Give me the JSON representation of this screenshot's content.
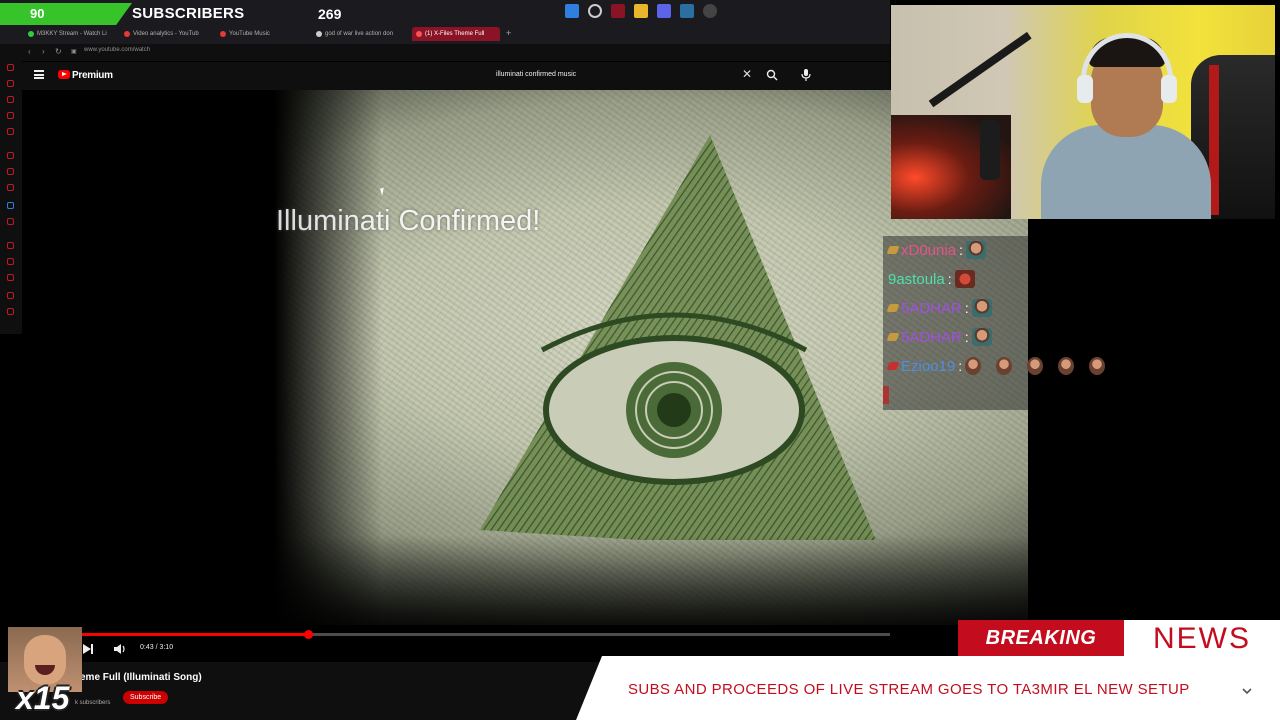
{
  "browser": {
    "tabs": [
      {
        "label": "M3KKY Stream - Watch Li",
        "color": "#2ecc40",
        "active": false
      },
      {
        "label": "Video analytics - YouTub",
        "color": "#e53935",
        "active": false
      },
      {
        "label": "YouTube Music",
        "color": "#e53935",
        "active": false
      },
      {
        "label": "god of war live action don",
        "color": "#cccccc",
        "active": false
      },
      {
        "label": "(1) X-Files Theme Full",
        "color": "#e53935",
        "active": true
      }
    ],
    "url": "www.youtube.com/watch"
  },
  "youtube": {
    "logo_label": "Premium",
    "search_query": "illuminati confirmed music",
    "video_caption": "Illuminati Confirmed!",
    "time_display": "0:43 / 3:10",
    "progress_fraction": 0.33,
    "video_title": "eme Full (Illuminati Song)",
    "subscribe_label": "Subscribe",
    "subscribers_label": "k subscribers"
  },
  "sub_counter": {
    "count": "90",
    "label": "SUBSCRIBERS",
    "goal": "269"
  },
  "chat": [
    {
      "name": "xD0unia",
      "color": "#e8538a",
      "badge": true,
      "emote": "face"
    },
    {
      "name": "9astoula",
      "color": "#4fe0a8",
      "badge": false,
      "emote": "red"
    },
    {
      "name": "5ADHAR",
      "color": "#a24fe0",
      "badge": true,
      "emote": "face"
    },
    {
      "name": "5ADHAR",
      "color": "#a24fe0",
      "badge": true,
      "emote": "face"
    },
    {
      "name": "Ezioo19",
      "color": "#4f8fe0",
      "badge": true,
      "emote": "multi"
    }
  ],
  "breaking_news": {
    "breaking": "BREAKING",
    "news": "NEWS",
    "ticker": "SUBS AND PROCEEDS OF LIVE STREAM GOES TO TA3MIR EL NEW SETUP"
  },
  "emote_counter": {
    "count": "x15"
  },
  "colors": {
    "accent_red": "#c30d1e",
    "youtube_red": "#ff0000",
    "counter_green": "#36c42a"
  }
}
